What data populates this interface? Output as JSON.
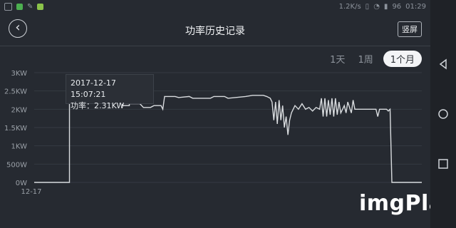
{
  "status": {
    "left_icons": [
      "signal-icon",
      "shield-icon",
      "edit-icon",
      "app-icon"
    ],
    "network_speed": "1.2K/s",
    "battery": "96",
    "time": "01:29",
    "icon_colors": {
      "shield": "#4caf50",
      "app": "#8bc34a"
    }
  },
  "header": {
    "title": "功率历史记录",
    "back_icon": "back-icon",
    "rotate_label": "竖屏"
  },
  "tabs": [
    {
      "label": "1天",
      "active": false
    },
    {
      "label": "1周",
      "active": false
    },
    {
      "label": "1个月",
      "active": true
    }
  ],
  "tooltip": {
    "datetime": "2017-12-17 15:07:21",
    "value_line": "功率：2.31KW"
  },
  "nav_icons": [
    "nav-back-icon",
    "nav-home-icon",
    "nav-recents-icon"
  ],
  "watermark": "imgPlay",
  "colors": {
    "background": "#262a31",
    "line": "#d9dcdf",
    "axis_text": "#9aa0a7",
    "accent": "#f3f4f6"
  },
  "chart_data": {
    "type": "line",
    "y_ticks": [
      "0W",
      "500W",
      "1KW",
      "1.5KW",
      "2KW",
      "2.5KW",
      "3KW"
    ],
    "x_ticks": [
      "12-17"
    ],
    "ylim": [
      0,
      3000
    ],
    "series": [
      {
        "points": [
          [
            0,
            0
          ],
          [
            0.1,
            0
          ],
          [
            0.1,
            2300
          ],
          [
            0.25,
            2300
          ],
          [
            0.25,
            2100
          ],
          [
            0.27,
            2100
          ],
          [
            0.27,
            2150
          ],
          [
            0.3,
            2150
          ],
          [
            0.31,
            2050
          ],
          [
            0.33,
            2050
          ],
          [
            0.34,
            2100
          ],
          [
            0.36,
            2100
          ],
          [
            0.365,
            2000
          ],
          [
            0.37,
            2350
          ],
          [
            0.4,
            2350
          ],
          [
            0.41,
            2320
          ],
          [
            0.44,
            2350
          ],
          [
            0.45,
            2300
          ],
          [
            0.5,
            2300
          ],
          [
            0.51,
            2350
          ],
          [
            0.54,
            2350
          ],
          [
            0.55,
            2300
          ],
          [
            0.6,
            2350
          ],
          [
            0.62,
            2380
          ],
          [
            0.65,
            2380
          ],
          [
            0.66,
            2350
          ],
          [
            0.67,
            2300
          ],
          [
            0.675,
            2200
          ],
          [
            0.68,
            1700
          ],
          [
            0.685,
            2200
          ],
          [
            0.69,
            1600
          ],
          [
            0.695,
            2250
          ],
          [
            0.7,
            1700
          ],
          [
            0.705,
            2100
          ],
          [
            0.71,
            1500
          ],
          [
            0.715,
            1800
          ],
          [
            0.72,
            1300
          ],
          [
            0.725,
            1700
          ],
          [
            0.73,
            1900
          ],
          [
            0.74,
            2100
          ],
          [
            0.75,
            2000
          ],
          [
            0.76,
            2150
          ],
          [
            0.77,
            2000
          ],
          [
            0.78,
            2050
          ],
          [
            0.79,
            1950
          ],
          [
            0.8,
            2050
          ],
          [
            0.81,
            2000
          ],
          [
            0.815,
            2300
          ],
          [
            0.82,
            1800
          ],
          [
            0.825,
            2300
          ],
          [
            0.83,
            1800
          ],
          [
            0.835,
            2250
          ],
          [
            0.84,
            1850
          ],
          [
            0.845,
            2300
          ],
          [
            0.85,
            1800
          ],
          [
            0.855,
            2300
          ],
          [
            0.86,
            1850
          ],
          [
            0.865,
            2200
          ],
          [
            0.87,
            1900
          ],
          [
            0.88,
            2100
          ],
          [
            0.885,
            1900
          ],
          [
            0.89,
            2200
          ],
          [
            0.9,
            1900
          ],
          [
            0.905,
            2250
          ],
          [
            0.91,
            2000
          ],
          [
            0.92,
            2000
          ],
          [
            0.95,
            2000
          ],
          [
            0.97,
            2000
          ],
          [
            0.975,
            1800
          ],
          [
            0.98,
            2000
          ],
          [
            1.0,
            2000
          ],
          [
            1.005,
            1950
          ],
          [
            1.01,
            2000
          ],
          [
            1.015,
            0
          ],
          [
            1.1,
            0
          ]
        ]
      }
    ]
  }
}
